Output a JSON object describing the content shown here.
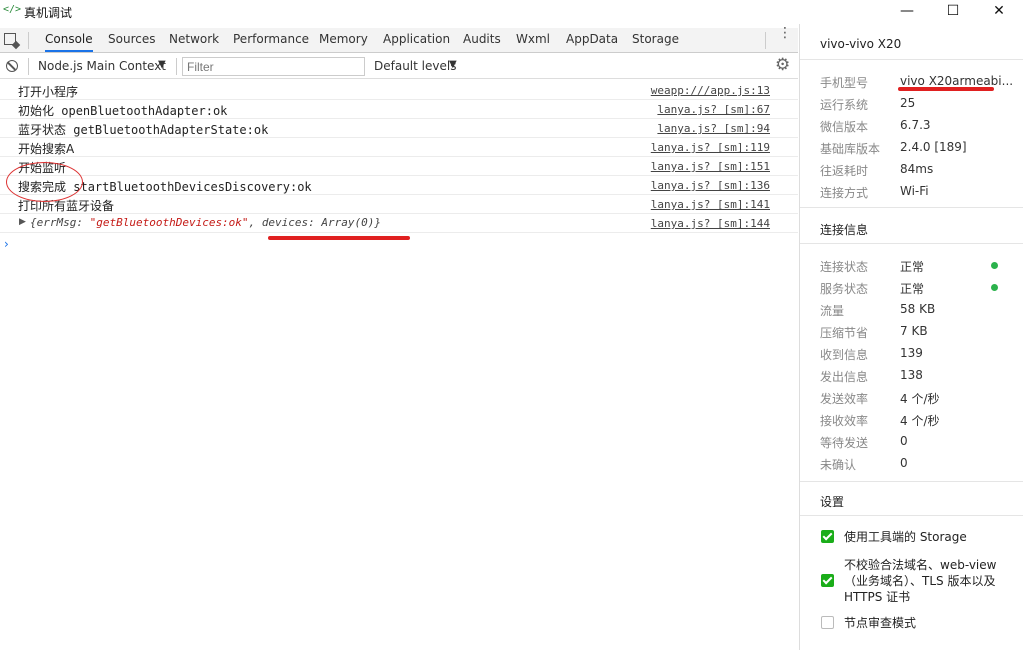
{
  "window": {
    "icon": "</>",
    "title": "真机调试",
    "minimize": "—",
    "maximize": "☐",
    "close": "✕"
  },
  "tabs": [
    "Console",
    "Sources",
    "Network",
    "Performance",
    "Memory",
    "Application",
    "Audits",
    "Wxml",
    "AppData",
    "Storage"
  ],
  "active_tab": "Console",
  "toolbar": {
    "context": "Node.js Main Context",
    "context_caret": "▼",
    "filter_placeholder": "Filter",
    "levels": "Default levels",
    "levels_caret": "▼",
    "kebab": "⋮",
    "gear": "⚙"
  },
  "logs": [
    {
      "msg": "打开小程序",
      "src": "weapp:///app.js:13"
    },
    {
      "msg_zh": "初始化",
      "msg_code": " openBluetoothAdapter:ok",
      "src": "lanya.js? [sm]:67"
    },
    {
      "msg_zh": "蓝牙状态",
      "msg_code": " getBluetoothAdapterState:ok",
      "src": "lanya.js? [sm]:94"
    },
    {
      "msg": "开始搜索A",
      "src": "lanya.js? [sm]:119"
    },
    {
      "msg": "开始监听",
      "src": "lanya.js? [sm]:151"
    },
    {
      "msg_zh": "搜索完成",
      "msg_code": " startBluetoothDevicesDiscovery:ok",
      "src": "lanya.js? [sm]:136"
    },
    {
      "msg": "打印所有蓝牙设备",
      "src": "lanya.js? [sm]:141"
    }
  ],
  "object_log": {
    "arrow": "▶",
    "open": "{errMsg: ",
    "str": "\"getBluetoothDevices:ok\"",
    "mid": ", ",
    "key": "devices",
    "rest": ": Array(0)}",
    "src": "lanya.js? [sm]:144"
  },
  "prompt": "›",
  "device": {
    "title": "vivo-vivo X20",
    "info": [
      {
        "label": "手机型号",
        "value": "vivo X20armeabi..."
      },
      {
        "label": "运行系统",
        "value": "25"
      },
      {
        "label": "微信版本",
        "value": "6.7.3"
      },
      {
        "label": "基础库版本",
        "value": "2.4.0 [189]"
      },
      {
        "label": "往返耗时",
        "value": "84ms"
      },
      {
        "label": "连接方式",
        "value": "Wi-Fi"
      }
    ]
  },
  "connection": {
    "title": "连接信息",
    "status_color": "#2bb24c",
    "rows": [
      {
        "label": "连接状态",
        "value": "正常"
      },
      {
        "label": "服务状态",
        "value": "正常"
      },
      {
        "label": "流量",
        "value": "58 KB"
      },
      {
        "label": "压缩节省",
        "value": "7 KB"
      },
      {
        "label": "收到信息",
        "value": "139"
      },
      {
        "label": "发出信息",
        "value": "138"
      },
      {
        "label": "发送效率",
        "value": "4 个/秒"
      },
      {
        "label": "接收效率",
        "value": "4 个/秒"
      },
      {
        "label": "等待发送",
        "value": "0"
      },
      {
        "label": "未确认",
        "value": "0"
      }
    ]
  },
  "settings": {
    "title": "设置",
    "options": [
      {
        "label": "使用工具端的 Storage",
        "checked": true
      },
      {
        "label": "不校验合法域名、web-view（业务域名）、TLS 版本以及 HTTPS 证书",
        "checked": true
      },
      {
        "label": "节点审查模式",
        "checked": false
      }
    ]
  },
  "colors": {
    "accent": "#1a73e8",
    "annotation": "#e02020",
    "checkbox": "#1aad19"
  }
}
